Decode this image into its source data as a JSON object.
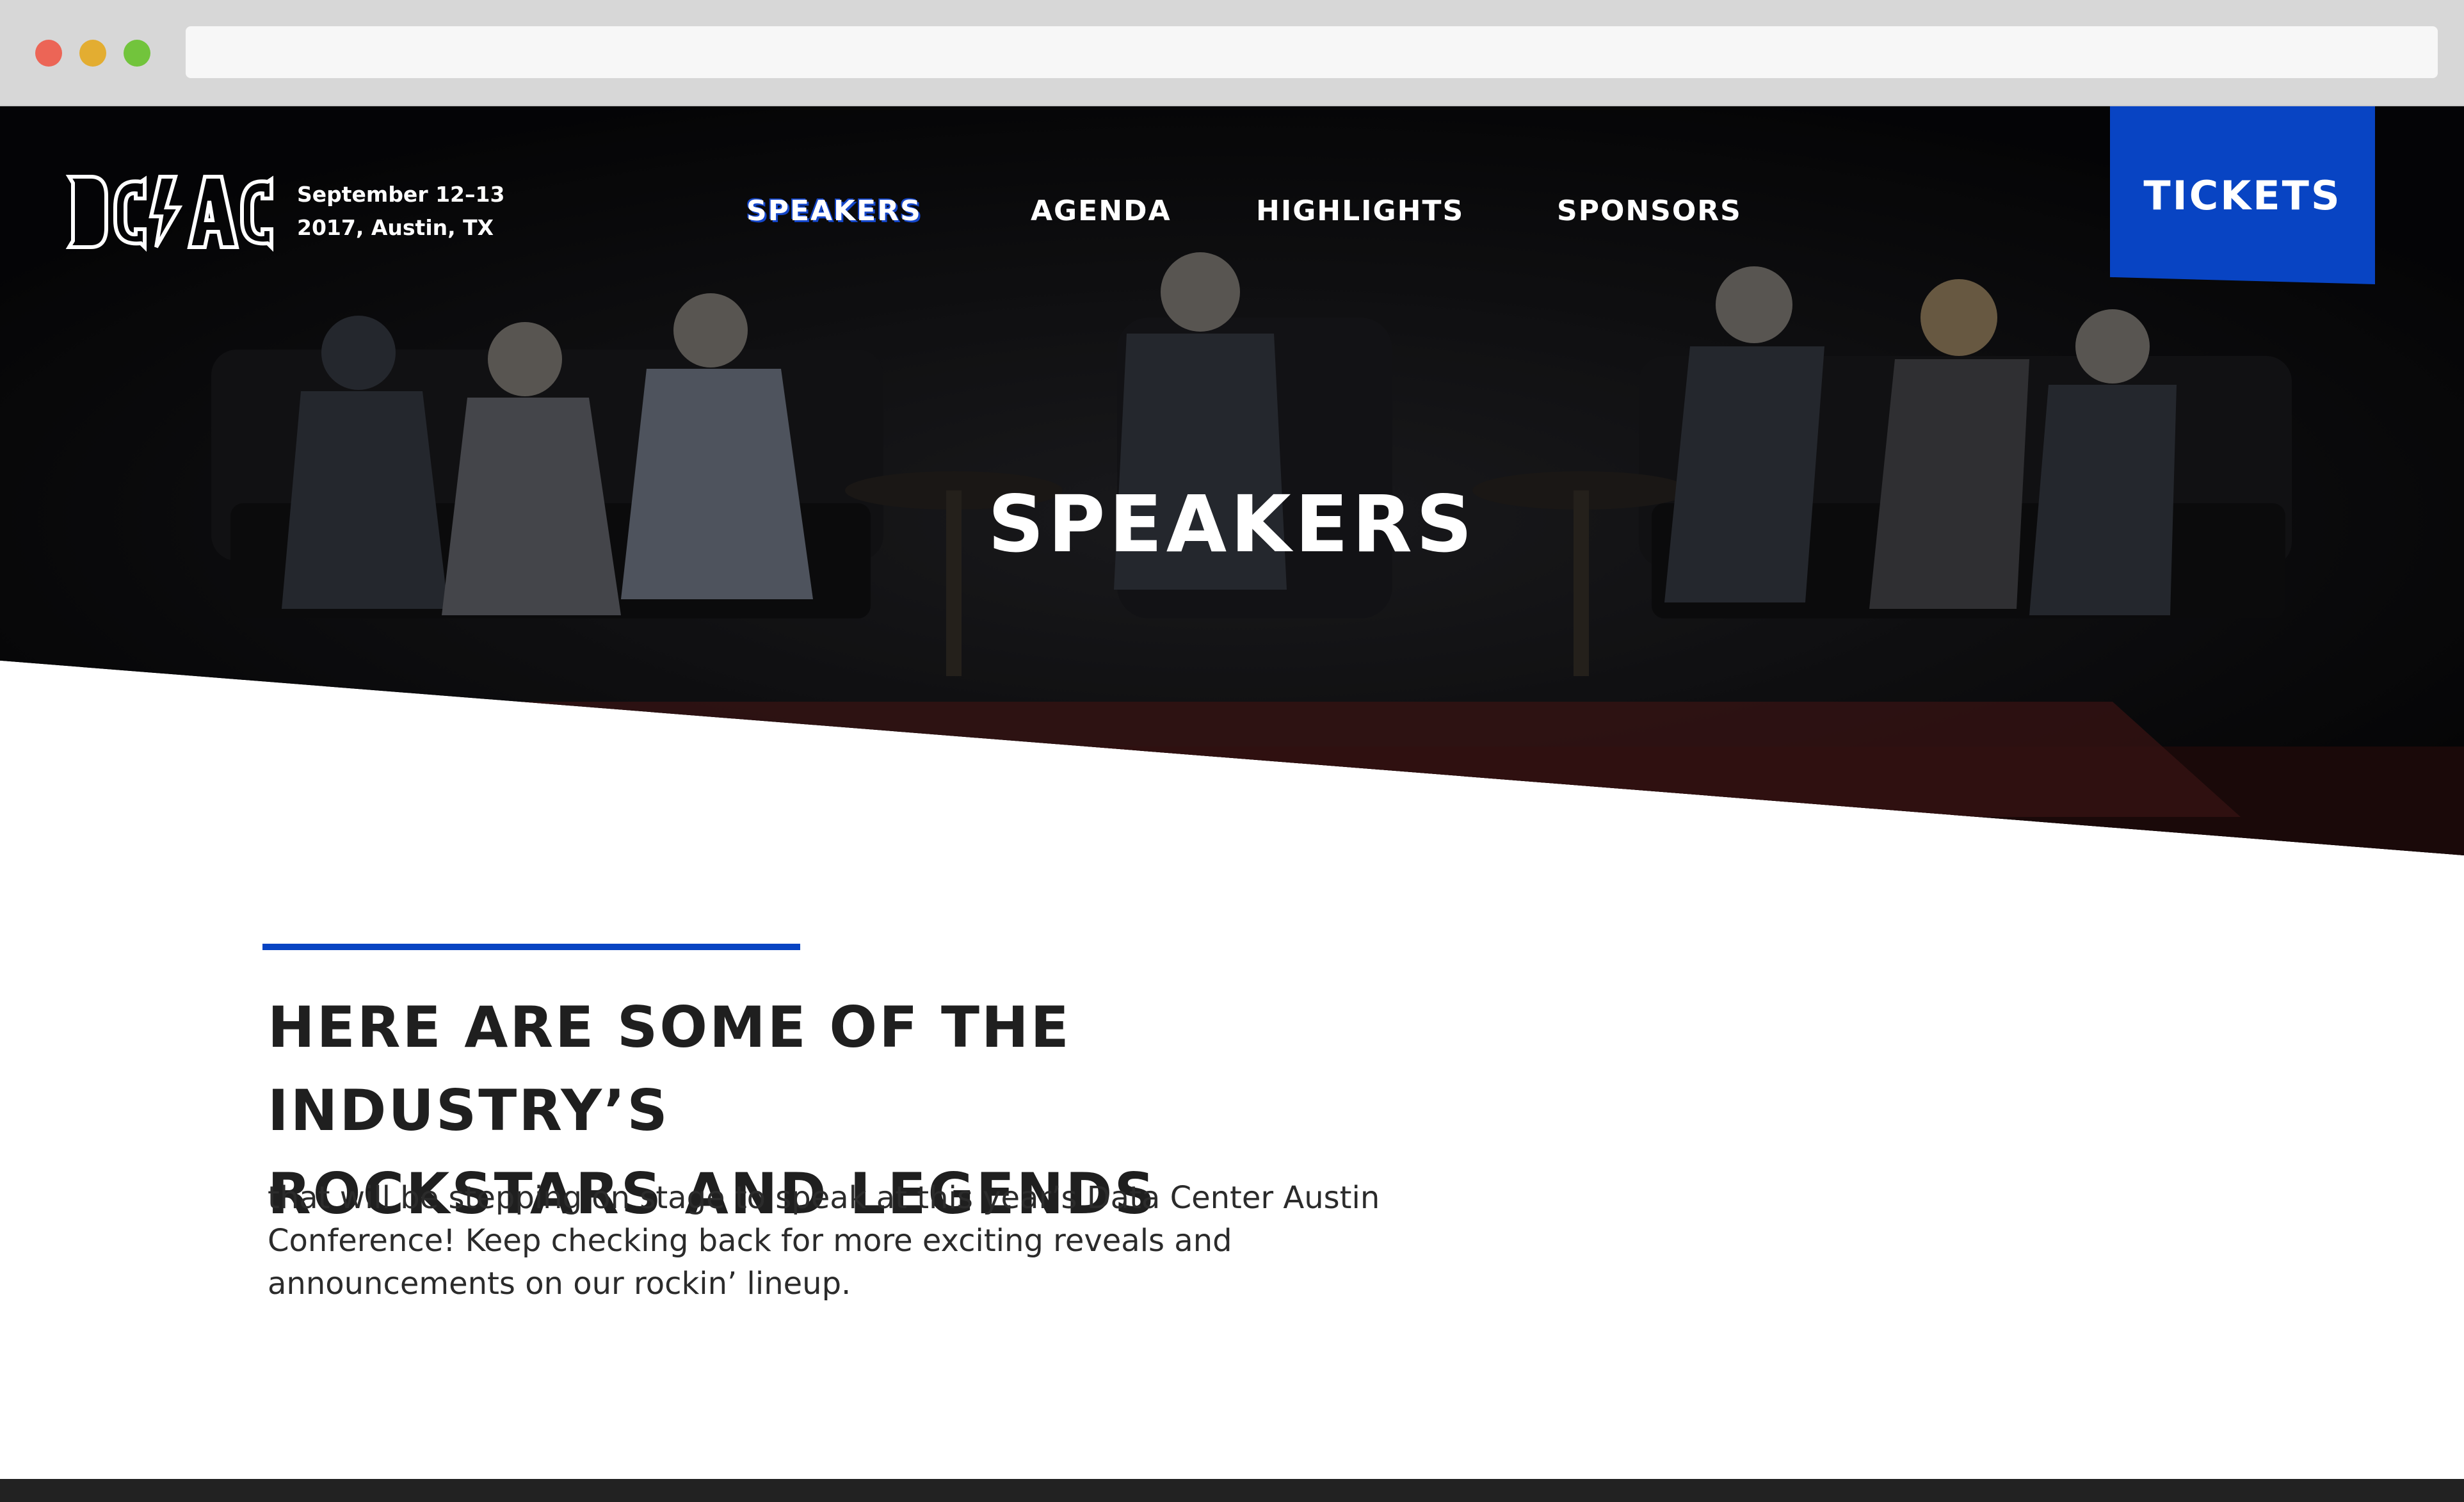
{
  "browser": {
    "address_value": ""
  },
  "header": {
    "logo_text": "DC/AC",
    "event_date_line1": "September 12–13",
    "event_date_line2": "2017, Austin, TX",
    "nav": [
      {
        "label": "Speakers",
        "active": true
      },
      {
        "label": "Agenda",
        "active": false
      },
      {
        "label": "Highlights",
        "active": false
      },
      {
        "label": "Sponsors",
        "active": false
      }
    ],
    "tickets_label": "Tickets"
  },
  "hero": {
    "title": "Speakers"
  },
  "intro": {
    "headline_line1": "Here are some of the industry’s",
    "headline_line2": "rockstars and legends",
    "body": "that will be stepping on stage to speak at this year’s Data Center Austin Conference! Keep checking back for more exciting reveals and announcements on our rockin’ lineup."
  },
  "colors": {
    "accent": "#0844c3",
    "hero_bg": "#0c0c0d",
    "text_dark": "#1f1f1f",
    "footer": "#222222"
  }
}
